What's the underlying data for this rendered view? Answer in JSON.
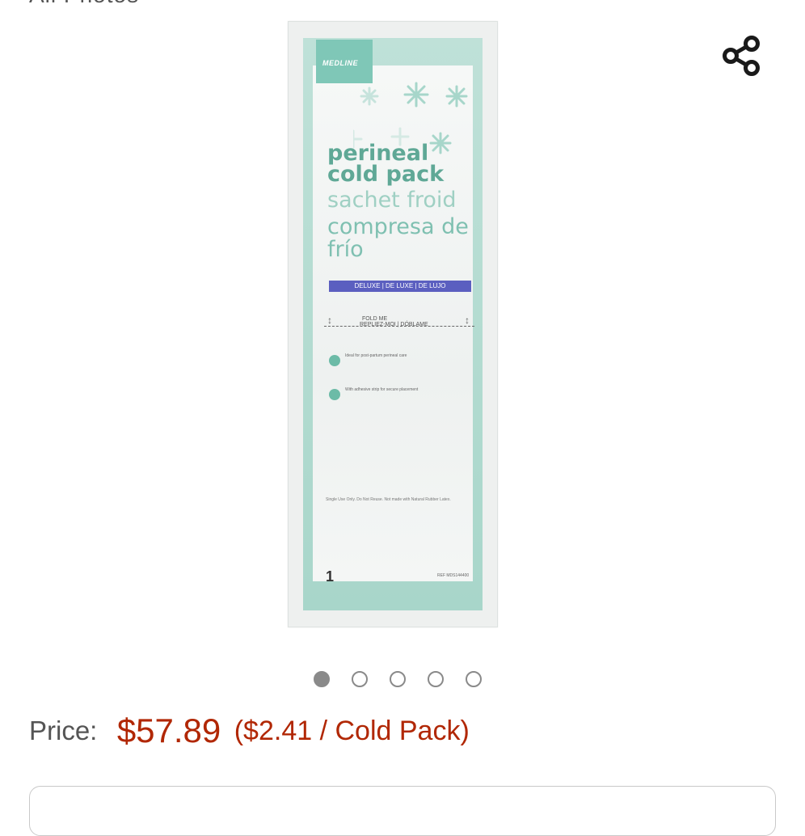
{
  "header": {
    "partial_title": "All Photos"
  },
  "share": {
    "icon": "share-icon"
  },
  "product": {
    "logo_text": "MEDLINE",
    "title_en": "perineal cold pack",
    "title_fr": "sachet froid",
    "title_es": "compresa de frío",
    "deluxe": "DELUXE | DE LUXE | DE LUJO",
    "fold_1": "FOLD ME",
    "fold_2": "REPLIEZ-MOI | DÓBLAME",
    "feature_1": "Ideal for post-partum perineal care",
    "feature_2": "With adhesive strip for secure placement",
    "small_print": "Single Use Only. Do Not Reuse. Not made with Natural Rubber Latex.",
    "count": "1",
    "ref": "REF MDS144400"
  },
  "carousel": {
    "total": 5,
    "active": 0
  },
  "price": {
    "label": "Price:",
    "value": "$57.89",
    "unit_price": "($2.41 / Cold Pack)"
  },
  "colors": {
    "price": "#b12704",
    "accent": "#7fc7b7"
  }
}
